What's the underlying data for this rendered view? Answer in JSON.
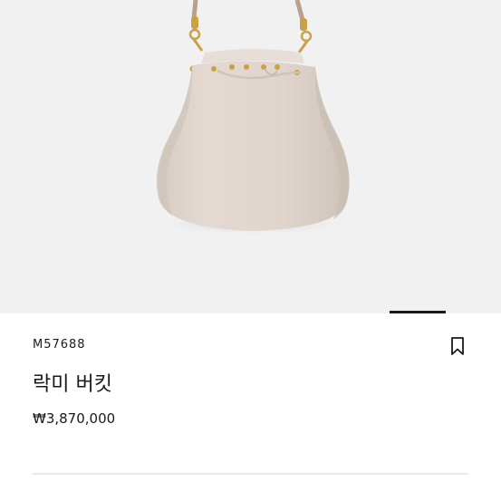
{
  "product": {
    "sku": "M57688",
    "name": "락미 버킷",
    "price": "₩3,870,000",
    "color": "#ded3cb"
  },
  "icons": {
    "wishlist": "bookmark-icon"
  }
}
